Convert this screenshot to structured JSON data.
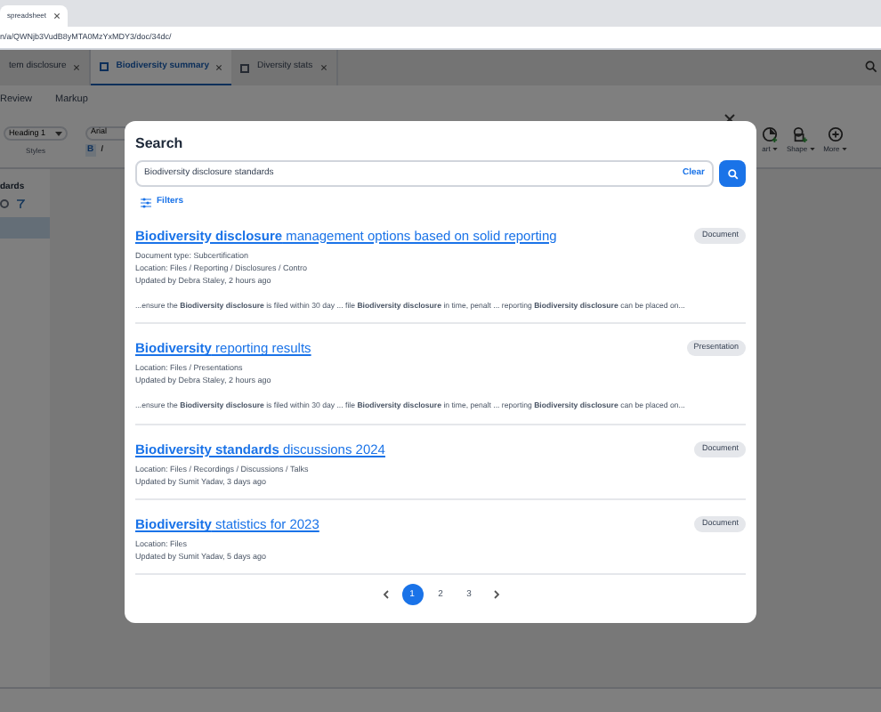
{
  "browser": {
    "tab": "spreadsheet",
    "address": "n/a/QWNjb3VudB8yMTA0MzYxMDY3/doc/34dc/"
  },
  "doc_tabs": [
    {
      "label": "tem disclosure",
      "selected": false
    },
    {
      "label": "Biodiversity summary",
      "selected": true
    },
    {
      "label": "Diversity stats",
      "selected": false
    }
  ],
  "menu": [
    "Review",
    "Markup"
  ],
  "toolbar": {
    "style": "Heading 1",
    "styles_label": "Styles",
    "font": "Arial",
    "bold": "B",
    "italic": "I",
    "tools": [
      {
        "kind": "chart",
        "label": "art"
      },
      {
        "kind": "shape",
        "label": "Shape"
      },
      {
        "kind": "more",
        "label": "More"
      }
    ]
  },
  "sidebar": {
    "title": "dards"
  },
  "search_dialog": {
    "title": "Search",
    "query": "Biodiversity disclosure standards",
    "clear": "Clear",
    "filters": "Filters",
    "results": [
      {
        "title": "**Biodiversity disclosure** management options based on solid reporting",
        "type": "Document",
        "details": [
          "Document type: Subcertification",
          "Location: Files / Reporting / Disclosures / Contro",
          "Updated by Debra Staley, 2 hours ago"
        ],
        "snippet": "...ensure the **Biodiversity disclosure** is filed within 30 day ... file **Biodiversity disclosure** in time, penalt ... reporting **Biodiversity disclosure** can be placed on..."
      },
      {
        "title": "**Biodiversity** reporting results",
        "type": "Presentation",
        "details": [
          "Location: Files / Presentations",
          "Updated by Debra Staley, 2 hours ago"
        ],
        "snippet": "...ensure the **Biodiversity disclosure** is filed within 30 day ... file **Biodiversity disclosure** in time, penalt ... reporting **Biodiversity disclosure** can be placed on..."
      },
      {
        "title": "**Biodiversity standards** discussions 2024",
        "type": "Document",
        "details": [
          "Location: Files / Recordings / Discussions / Talks",
          "Updated by Sumit Yadav, 3 days ago"
        ]
      },
      {
        "title": "**Biodiversity** statistics for 2023",
        "type": "Document",
        "details": [
          "Location: Files",
          "Updated by Sumit Yadav, 5 days ago"
        ]
      }
    ],
    "pages": [
      {
        "label": "1",
        "selected": true
      },
      {
        "label": "2",
        "selected": false
      },
      {
        "label": "3",
        "selected": false
      }
    ]
  }
}
